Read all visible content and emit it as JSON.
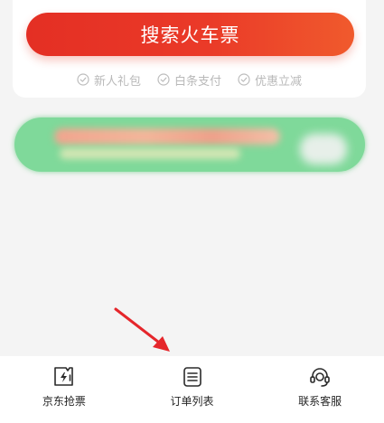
{
  "search_button": {
    "label": "搜索火车票"
  },
  "perks": [
    {
      "label": "新人礼包",
      "icon": "check-circle-icon"
    },
    {
      "label": "白条支付",
      "icon": "check-circle-icon"
    },
    {
      "label": "优惠立减",
      "icon": "check-circle-icon"
    }
  ],
  "banner": {
    "icon": "blurred-promo-banner",
    "color": "#7fd99a"
  },
  "annotation": {
    "icon": "red-arrow",
    "color": "#e5262b"
  },
  "tabbar": {
    "tabs": [
      {
        "label": "京东抢票",
        "icon": "ticket-lightning-icon"
      },
      {
        "label": "订单列表",
        "icon": "order-list-icon"
      },
      {
        "label": "联系客服",
        "icon": "customer-service-headset-icon"
      }
    ]
  },
  "colors": {
    "primary_red": "#e42f24",
    "perk_gray": "#b9b9b9",
    "background": "#f4f4f4"
  }
}
